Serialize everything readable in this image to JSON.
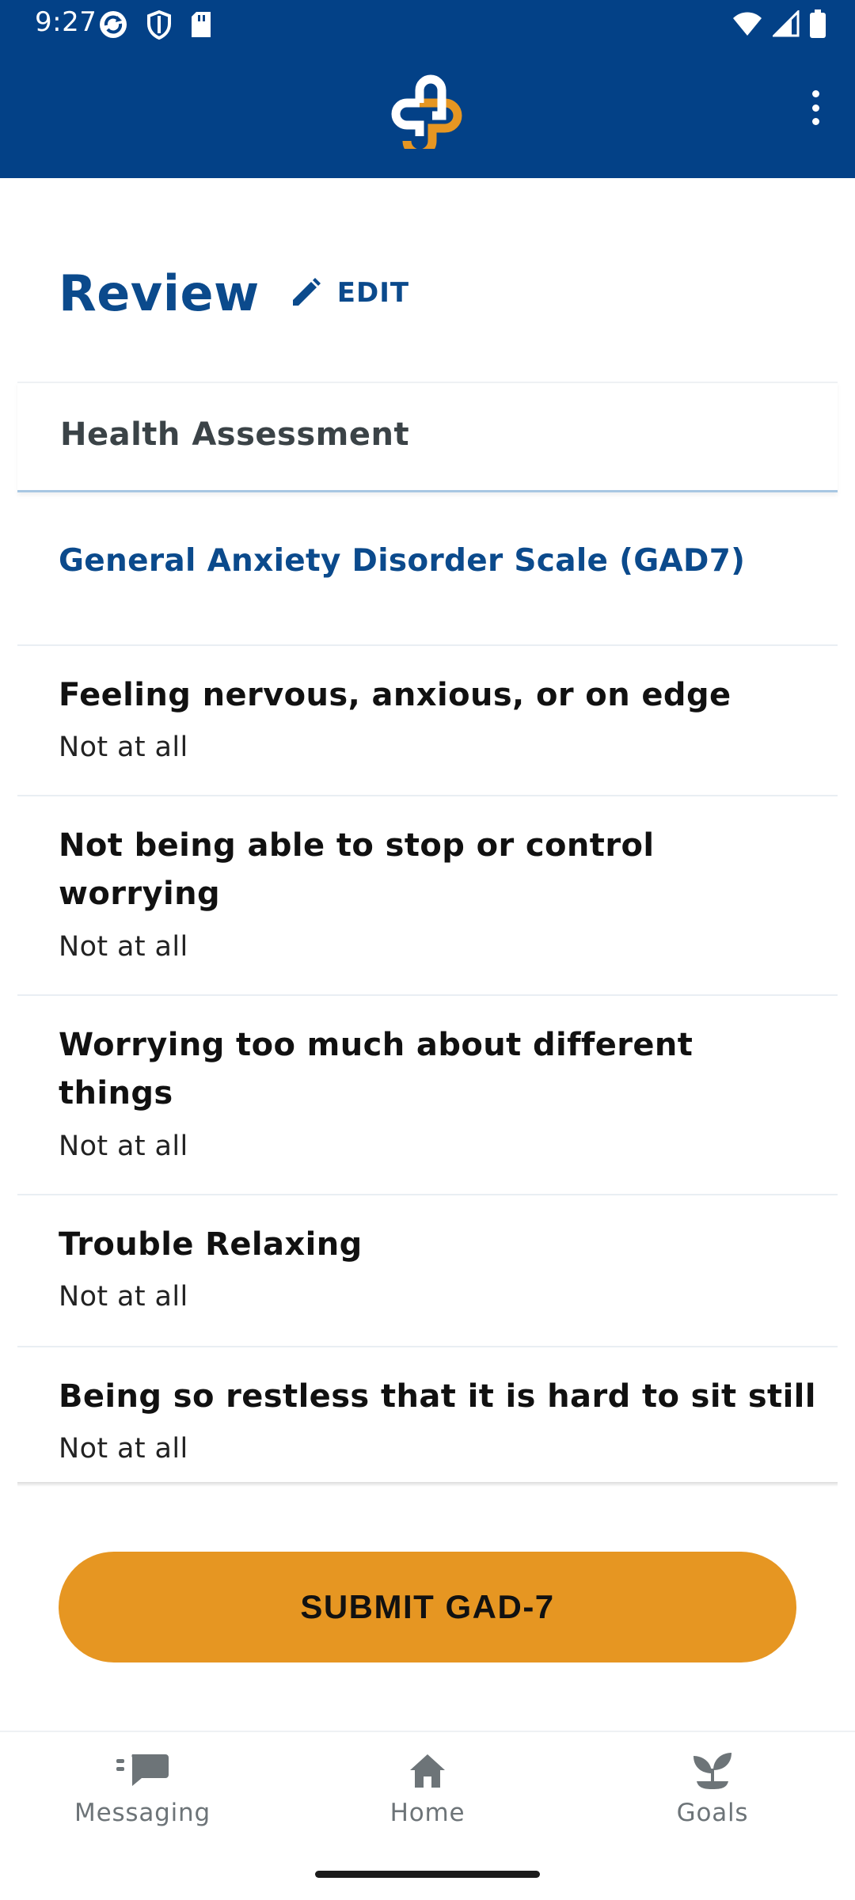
{
  "status_bar": {
    "time": "9:27"
  },
  "review": {
    "title": "Review",
    "edit_label": "EDIT"
  },
  "section": {
    "header": "Health Assessment",
    "scale_title": "General Anxiety Disorder Scale (GAD7)"
  },
  "questions": [
    {
      "text": "Feeling nervous, anxious, or on edge",
      "answer": "Not at all"
    },
    {
      "text": "Not being able to stop or control worrying",
      "answer": "Not at all"
    },
    {
      "text": "Worrying too much about different things",
      "answer": "Not at all"
    },
    {
      "text": "Trouble Relaxing",
      "answer": "Not at all"
    },
    {
      "text": "Being so restless that it is hard to sit still",
      "answer": "Not at all"
    }
  ],
  "submit": {
    "label": "SUBMIT GAD-7"
  },
  "bottom_nav": {
    "items": [
      {
        "label": "Messaging",
        "icon": "chat-icon"
      },
      {
        "label": "Home",
        "icon": "home-icon"
      },
      {
        "label": "Goals",
        "icon": "sprout-icon"
      }
    ]
  },
  "colors": {
    "app_bar": "#034187",
    "primary_text": "#0b4a8c",
    "accent": "#e69622",
    "nav_inactive": "#6d7478"
  }
}
